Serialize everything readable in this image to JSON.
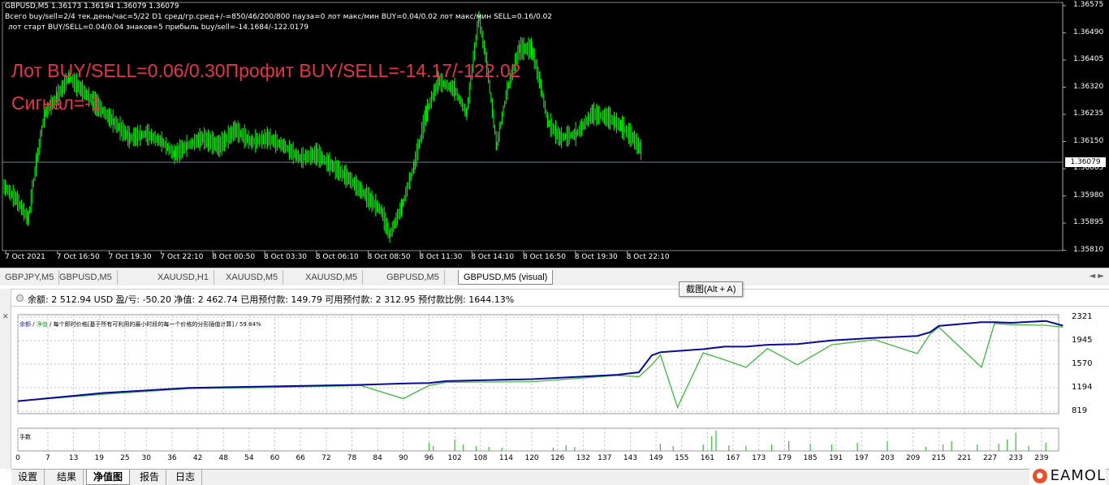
{
  "price_chart": {
    "ohlc_line": "GBPUSD,M5  1.36173 1.36194 1.36079 1.36079",
    "info_line1": "Всего buy/sell=2/4 тек.день/час=5/22 D1 сред/гр.сред+/-=850/46/200/800 пауза=0 лот макс/мин BUY=0.04/0.02 лот макс/мин SELL=0.16/0.02",
    "info_line2": "лот старт BUY/SELL=0.04/0.04 знаков=5 прибыль buy/sell=-14.1684/-122.0179",
    "overlay_line1": "Лот BUY/SELL=0.06/0.30Профит BUY/SELL=-14.17/-122.02",
    "overlay_line2": "Сигнал=-1",
    "current_price": "1.36079",
    "price_ticks": [
      "1.36575",
      "1.36490",
      "1.36405",
      "1.36320",
      "1.36235",
      "1.36150",
      "1.36065",
      "1.35980",
      "1.35895",
      "1.35810"
    ],
    "time_ticks": [
      "7 Oct 2021",
      "7 Oct 16:50",
      "7 Oct 19:30",
      "7 Oct 22:10",
      "8 Oct 00:50",
      "8 Oct 03:30",
      "8 Oct 06:10",
      "8 Oct 08:50",
      "8 Oct 11:30",
      "8 Oct 14:10",
      "8 Oct 16:50",
      "8 Oct 19:30",
      "8 Oct 22:10"
    ],
    "colors": {
      "background": "#000000",
      "candles": "#00ff00",
      "overlay_text": "#e8324a",
      "price_line": "#708090"
    }
  },
  "chart_tabs": [
    {
      "label": "GBPJPY,M5",
      "active": false
    },
    {
      "label": "GBPUSD,M5",
      "active": false
    },
    {
      "label": "XAUUSD,H1",
      "active": false
    },
    {
      "label": "XAUUSD,M5",
      "active": false
    },
    {
      "label": "XAUUSD,M5",
      "active": false
    },
    {
      "label": "GBPUSD,M5",
      "active": false
    },
    {
      "label": "GBPUSD,M5 (visual)",
      "active": true
    }
  ],
  "tab_scroll": "◄ ►",
  "tooltip": "截图(Alt + A)",
  "account": {
    "text": "余额: 2 512.94 USD   盈/亏: -50.20   净值: 2 462.74   已用预付款: 149.79   可用预付款: 2 312.95   预付款比例: 1644.13%"
  },
  "equity_chart": {
    "legend_balance": "余额",
    "legend_sep1": " / ",
    "legend_equity": "净值",
    "legend_rest": " / 每个即时价格[基于所有可利用的最小时段的每一个价格的分形插值计算] / 59.84%",
    "lots_label": "手数",
    "y_ticks": [
      "2321",
      "1945",
      "1570",
      "1194",
      "819"
    ],
    "x_ticks": [
      "0",
      "7",
      "13",
      "19",
      "25",
      "30",
      "36",
      "42",
      "48",
      "54",
      "60",
      "66",
      "72",
      "78",
      "84",
      "90",
      "96",
      "102",
      "108",
      "114",
      "120",
      "126",
      "132",
      "137",
      "143",
      "149",
      "155",
      "161",
      "167",
      "173",
      "179",
      "185",
      "191",
      "197",
      "203",
      "209",
      "215",
      "221",
      "227",
      "233",
      "239"
    ],
    "colors": {
      "balance": "#0a0a9a",
      "equity": "#3cb83c",
      "grid": "#bfbfbf"
    }
  },
  "chart_data": {
    "type": "line",
    "x": [
      0,
      20,
      40,
      60,
      80,
      90,
      96,
      100,
      120,
      140,
      145,
      148,
      150,
      154,
      160,
      165,
      170,
      175,
      182,
      190,
      200,
      210,
      213,
      215,
      225,
      228,
      232,
      240,
      244
    ],
    "series": [
      {
        "name": "余额",
        "values": [
          980,
          1110,
          1190,
          1215,
          1240,
          1260,
          1270,
          1300,
          1330,
          1400,
          1440,
          1710,
          1760,
          1780,
          1810,
          1850,
          1850,
          1880,
          1890,
          1950,
          1990,
          2020,
          2080,
          2180,
          2240,
          2240,
          2230,
          2260,
          2185
        ]
      },
      {
        "name": "净值",
        "values": [
          980,
          1090,
          1180,
          1200,
          1230,
          1020,
          1230,
          1280,
          1290,
          1390,
          1370,
          1560,
          1720,
          880,
          1750,
          1640,
          1520,
          1820,
          1560,
          1880,
          1960,
          1740,
          2050,
          2160,
          1520,
          2220,
          2200,
          2190,
          2160
        ]
      }
    ],
    "lots_bars_note": "",
    "ylim": [
      819,
      2321
    ],
    "xlim": [
      0,
      243
    ]
  }
}
